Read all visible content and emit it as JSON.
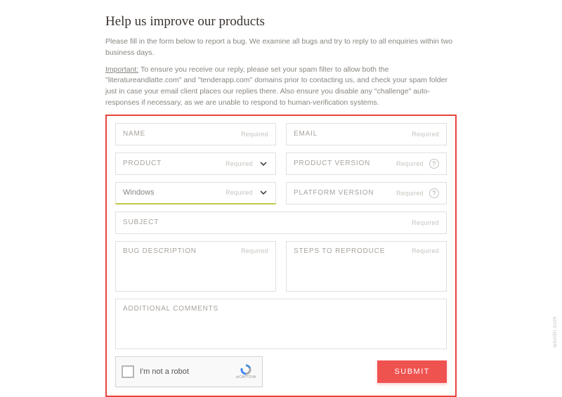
{
  "header": {
    "title": "Help us improve our products",
    "intro1": "Please fill in the form below to report a bug. We examine all bugs and try to reply to all enquiries within two business days.",
    "important_label": "Important:",
    "intro2": " To ensure you receive our reply, please set your spam filter to allow both the \"literatureandlatte.com\" and \"tenderapp.com\" domains prior to contacting us, and check your spam folder just in case your email client places our replies there. Also ensure you disable any \"challenge\" auto-responses if necessary, as we are unable to respond to human-verification systems."
  },
  "form": {
    "required_label": "Required",
    "name": {
      "label": "NAME"
    },
    "email": {
      "label": "EMAIL"
    },
    "product": {
      "label": "PRODUCT"
    },
    "product_version": {
      "label": "PRODUCT VERSION"
    },
    "platform": {
      "value": "Windows"
    },
    "platform_version": {
      "label": "PLATFORM VERSION"
    },
    "subject": {
      "label": "SUBJECT"
    },
    "bug_desc": {
      "label": "BUG DESCRIPTION"
    },
    "steps": {
      "label": "STEPS TO REPRODUCE"
    },
    "additional": {
      "label": "ADDITIONAL COMMENTS"
    }
  },
  "captcha": {
    "label": "I'm not a robot",
    "brand": "reCAPTCHA"
  },
  "submit_label": "SUBMIT",
  "watermark": "wsxdn.com"
}
